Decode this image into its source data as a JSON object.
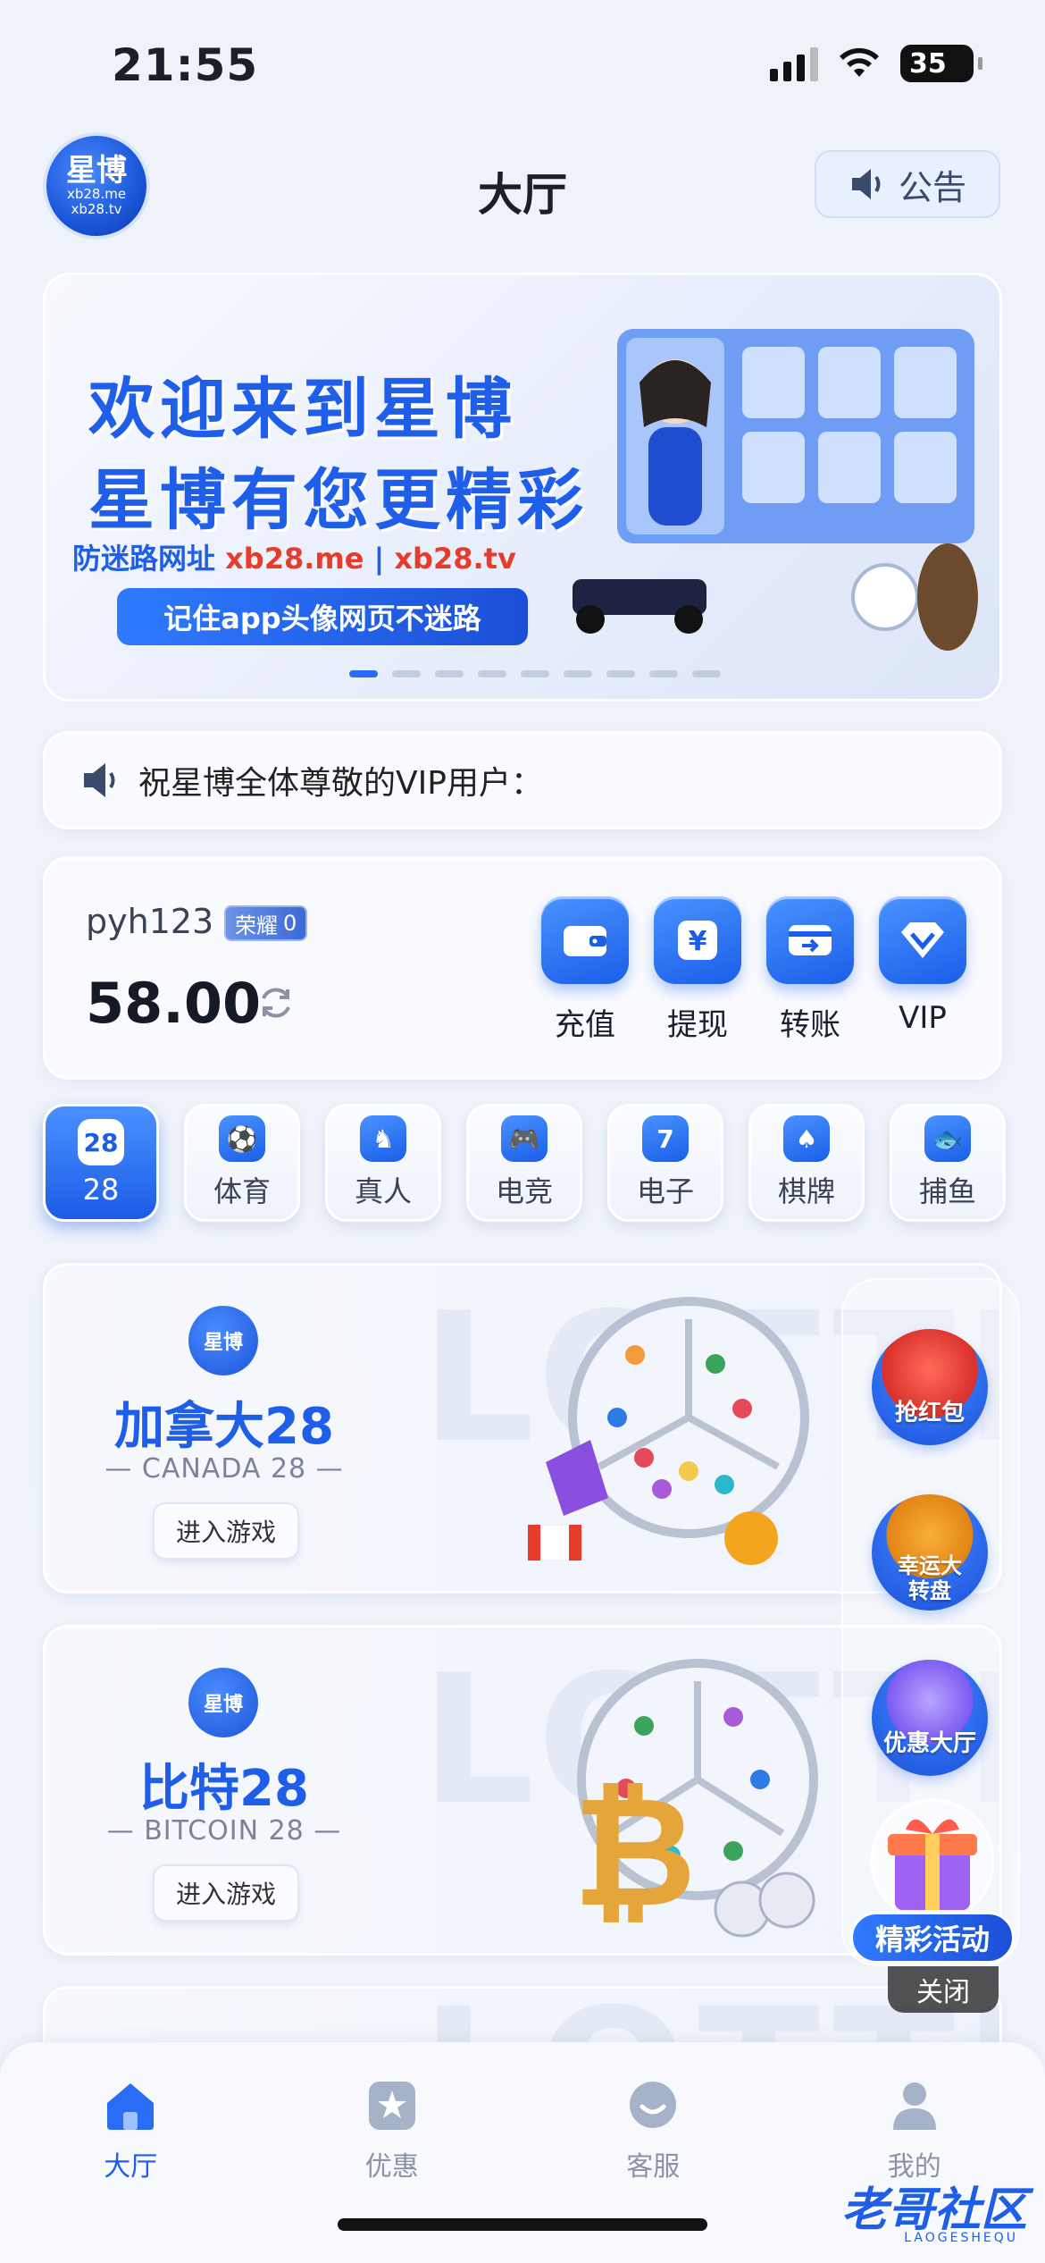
{
  "status_bar": {
    "time": "21:55",
    "battery": "35"
  },
  "header": {
    "logo_line1": "星博",
    "logo_line2": "xb28.me",
    "logo_line3": "xb28.tv",
    "title": "大厅",
    "notice_label": "公告"
  },
  "banner": {
    "line1": "欢迎来到星博",
    "line2": "星博有您更精彩",
    "sub_prefix": "防迷路网址",
    "sub_url1": "xb28.me",
    "sub_sep": "|",
    "sub_url2": "xb28.tv",
    "pill": "记住app头像网页不迷路",
    "dot_count": 9,
    "active_dot": 0
  },
  "marquee": {
    "text": "祝星博全体尊敬的VIP用户："
  },
  "wallet": {
    "username": "pyh123",
    "rank_label": "荣耀",
    "rank_level": "0",
    "balance": "58.00",
    "actions": [
      {
        "label": "充值",
        "icon": "wallet-icon"
      },
      {
        "label": "提现",
        "icon": "yen-icon"
      },
      {
        "label": "转账",
        "icon": "transfer-icon"
      },
      {
        "label": "VIP",
        "icon": "diamond-icon"
      }
    ]
  },
  "categories": [
    {
      "label": "28",
      "icon": "28",
      "active": true
    },
    {
      "label": "体育",
      "icon": "⚽"
    },
    {
      "label": "真人",
      "icon": "♞"
    },
    {
      "label": "电竞",
      "icon": "🎮"
    },
    {
      "label": "电子",
      "icon": "7"
    },
    {
      "label": "棋牌",
      "icon": "♠"
    },
    {
      "label": "捕鱼",
      "icon": "🐟"
    }
  ],
  "games": [
    {
      "title": "加拿大28",
      "subtitle": "— CANADA 28 —",
      "button": "进入游戏",
      "bg_text": "LOTTERY",
      "logo": "星博"
    },
    {
      "title": "比特28",
      "subtitle": "— BITCOIN 28 —",
      "button": "进入游戏",
      "bg_text": "LOTTERY",
      "logo": "星博"
    }
  ],
  "floating": {
    "red_packet": "抢红包",
    "wheel": "幸运大转盘",
    "promo_hall": "优惠大厅",
    "gift": "精彩活动",
    "close": "关闭"
  },
  "bottom_nav": [
    {
      "label": "大厅",
      "icon": "home-icon",
      "active": true
    },
    {
      "label": "优惠",
      "icon": "star-icon"
    },
    {
      "label": "客服",
      "icon": "chat-icon"
    },
    {
      "label": "我的",
      "icon": "user-icon"
    }
  ],
  "watermark": {
    "text": "老哥社区",
    "sub": "LAOGESHEQU"
  },
  "colors": {
    "primary": "#1f5ee8",
    "accent_red": "#e53c2c",
    "background": "#eef2f9"
  }
}
